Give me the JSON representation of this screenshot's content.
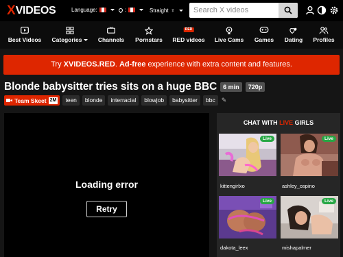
{
  "header": {
    "logo_x": "X",
    "logo_text": "VIDEOS",
    "language_label": "Language:",
    "country_label": ":",
    "orientation_label": "Straight",
    "search_placeholder": "Search X videos",
    "icons": [
      "user-icon",
      "contrast-icon",
      "settings-icon"
    ]
  },
  "nav": {
    "items": [
      {
        "label": "Best Videos",
        "icon": "play-box-icon"
      },
      {
        "label": "Categories",
        "icon": "grid-icon"
      },
      {
        "label": "Channels",
        "icon": "tv-icon"
      },
      {
        "label": "Pornstars",
        "icon": "star-icon"
      },
      {
        "label": "RED videos",
        "icon": "red-badge-icon",
        "badge": "RED"
      },
      {
        "label": "Live Cams",
        "icon": "webcam-icon"
      },
      {
        "label": "Games",
        "icon": "gamepad-icon"
      },
      {
        "label": "Dating",
        "icon": "hearts-icon"
      },
      {
        "label": "Profiles",
        "icon": "users-icon"
      }
    ]
  },
  "banner": {
    "pre": "Try ",
    "brand": "XVIDEOS.RED",
    "mid": ". ",
    "bold": "Ad-free",
    "post": " experience with extra content and features."
  },
  "video": {
    "title": "Blonde babysitter tries sits on a huge BBC",
    "duration": "6 min",
    "quality": "720p",
    "channel": "Team Skeet",
    "channel_count": "2M",
    "tags": [
      "teen",
      "blonde",
      "interracial",
      "blowjob",
      "babysitter",
      "bbc"
    ]
  },
  "player": {
    "error_text": "Loading error",
    "retry_label": "Retry"
  },
  "live_panel": {
    "heading_pre": "CHAT WITH ",
    "heading_hl": "LIVE",
    "heading_post": " GIRLS",
    "badge": "Live",
    "cams": [
      {
        "name": "kittengirlxo"
      },
      {
        "name": "ashley_ospino"
      },
      {
        "name": "dakota_leex"
      },
      {
        "name": "mishapalmer"
      }
    ]
  },
  "colors": {
    "brand_red": "#de2600",
    "live_green": "#28a745",
    "background": "#151515"
  }
}
